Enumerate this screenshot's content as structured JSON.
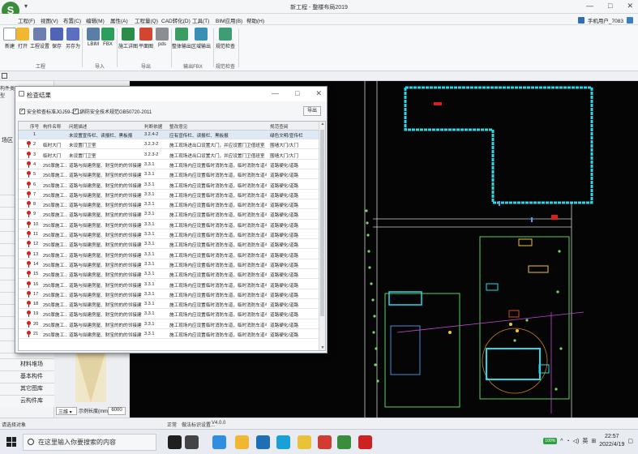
{
  "window": {
    "title": "新工程 - 整楼布局2019",
    "quick_access": "▾",
    "controls": [
      "—",
      "□",
      "✕"
    ]
  },
  "menu": {
    "items": [
      "工程(F)",
      "视图(V)",
      "布置(C)",
      "编辑(M)",
      "属性(A)",
      "工程量(Q)",
      "CAD转化(D)",
      "工具(T)",
      "BIM应用(B)",
      "帮助(H)"
    ],
    "user": "手机用户_7083"
  },
  "ribbon": {
    "buttons": [
      {
        "label": "新建",
        "icon": "new-file-icon",
        "color": "#e9eef5"
      },
      {
        "label": "打开",
        "icon": "open-folder-icon",
        "color": "#f2b731"
      },
      {
        "label": "工程设置",
        "icon": "project-settings-icon",
        "color": "#6c7fb0"
      },
      {
        "label": "保存",
        "icon": "save-icon",
        "color": "#4f63b8"
      },
      {
        "label": "另存为",
        "icon": "save-as-icon",
        "color": "#5a6fc0"
      },
      {
        "label": "LBIM",
        "icon": "lbim-icon",
        "color": "#5a7fa6"
      },
      {
        "label": "FBX",
        "icon": "fbx-icon",
        "color": "#2b9f5a"
      },
      {
        "label": "施工详图",
        "icon": "construction-drawing-icon",
        "color": "#2c8c4a"
      },
      {
        "label": "平面图",
        "icon": "floor-plan-icon",
        "color": "#d2462f"
      },
      {
        "label": "pds",
        "icon": "pds-icon",
        "color": "#8a8f96"
      },
      {
        "label": "整体输出",
        "icon": "export-all-icon",
        "color": "#3a9d63"
      },
      {
        "label": "区域输出",
        "icon": "export-region-icon",
        "color": "#3a8fb5"
      },
      {
        "label": "规范检查",
        "icon": "spec-check-icon",
        "color": "#3f9d76"
      }
    ],
    "groups": [
      "工程",
      "导入",
      "导出",
      "输出FBX",
      "规范检查"
    ]
  },
  "sidebar": {
    "header": "构件类型",
    "side_label": "场区",
    "items": [
      "材料堆场",
      "基本构件",
      "其它图库",
      "云构件库"
    ]
  },
  "preview": {
    "view_select": "三维",
    "scale_label": "示例长度(mm)",
    "scale_value": "6000"
  },
  "dialog": {
    "title": "检查结果",
    "checkboxes": [
      {
        "label": "安全检查标准JGJ59-2011",
        "checked": true
      },
      {
        "label": "消防安全技术规范GB50720-2011",
        "checked": true
      }
    ],
    "export_label": "导出",
    "columns": [
      "序号",
      "构件名称",
      "问题描述",
      "判断依据",
      "整改意见",
      "规范查阅"
    ],
    "rows": [
      {
        "no": "1",
        "pin": false,
        "name": "",
        "desc": "未设置宣传栏、读报栏、黑板报",
        "basis": "3.2.4-2",
        "fix": "应有宣传栏、读报栏、黑板报",
        "ref": "绿色文明/宣传栏"
      },
      {
        "no": "2",
        "pin": true,
        "name": "临时大门",
        "desc": "未设置门卫室",
        "basis": "3.2.3-2",
        "fix": "施工现场进出口设置大门，并应设置门卫值班室",
        "ref": "围墙大门/大门"
      },
      {
        "no": "3",
        "pin": true,
        "name": "临时大门",
        "desc": "未设置门卫室",
        "basis": "3.2.3-2",
        "fix": "施工现场进出口设置大门，并应设置门卫值班室",
        "ref": "围墙大门/大门"
      },
      {
        "no": "4",
        "pin": true,
        "name": "250厚施工...",
        "desc": "道路与拟建房屋、财宝的的的邻接建筑之...",
        "basis": "3.3.1",
        "fix": "施工现场内应设置临时消防车道，临时消防车道与在建...",
        "ref": "道路硬化/道路"
      },
      {
        "no": "5",
        "pin": true,
        "name": "250厚施工...",
        "desc": "道路与拟建房屋、财宝的的的邻接建筑之...",
        "basis": "3.3.1",
        "fix": "施工现场内应设置临时消防车道，临时消防车道与在建...",
        "ref": "道路硬化/道路"
      },
      {
        "no": "6",
        "pin": true,
        "name": "250厚施工...",
        "desc": "道路与拟建房屋、财宝的的的邻接建筑之...",
        "basis": "3.3.1",
        "fix": "施工现场内应设置临时消防车道，临时消防车道与在建...",
        "ref": "道路硬化/道路"
      },
      {
        "no": "7",
        "pin": true,
        "name": "250厚施工...",
        "desc": "道路与拟建房屋、财宝的的的邻接建筑之...",
        "basis": "3.3.1",
        "fix": "施工现场内应设置临时消防车道，临时消防车道与在建...",
        "ref": "道路硬化/道路"
      },
      {
        "no": "8",
        "pin": true,
        "name": "250厚施工...",
        "desc": "道路与拟建房屋、财宝的的的邻接建筑之...",
        "basis": "3.3.1",
        "fix": "施工现场内应设置临时消防车道，临时消防车道与在建...",
        "ref": "道路硬化/道路"
      },
      {
        "no": "9",
        "pin": true,
        "name": "250厚施工...",
        "desc": "道路与拟建房屋、财宝的的的邻接建筑之...",
        "basis": "3.3.1",
        "fix": "施工现场内应设置临时消防车道，临时消防车道与在建...",
        "ref": "道路硬化/道路"
      },
      {
        "no": "10",
        "pin": true,
        "name": "250厚施工...",
        "desc": "道路与拟建房屋、财宝的的的邻接建筑之...",
        "basis": "3.3.1",
        "fix": "施工现场内应设置临时消防车道，临时消防车道与在建...",
        "ref": "道路硬化/道路"
      },
      {
        "no": "11",
        "pin": true,
        "name": "250厚施工...",
        "desc": "道路与拟建房屋、财宝的的的邻接建筑之...",
        "basis": "3.3.1",
        "fix": "施工现场内应设置临时消防车道，临时消防车道与在建...",
        "ref": "道路硬化/道路"
      },
      {
        "no": "12",
        "pin": true,
        "name": "250厚施工...",
        "desc": "道路与拟建房屋、财宝的的的邻接建筑之...",
        "basis": "3.3.1",
        "fix": "施工现场内应设置临时消防车道，临时消防车道与在建...",
        "ref": "道路硬化/道路"
      },
      {
        "no": "13",
        "pin": true,
        "name": "250厚施工...",
        "desc": "道路与拟建房屋、财宝的的的邻接建筑之...",
        "basis": "3.3.1",
        "fix": "施工现场内应设置临时消防车道，临时消防车道与在建...",
        "ref": "道路硬化/道路"
      },
      {
        "no": "14",
        "pin": true,
        "name": "250厚施工...",
        "desc": "道路与拟建房屋、财宝的的的邻接建筑之...",
        "basis": "3.3.1",
        "fix": "施工现场内应设置临时消防车道，临时消防车道与在建...",
        "ref": "道路硬化/道路"
      },
      {
        "no": "15",
        "pin": true,
        "name": "250厚施工...",
        "desc": "道路与拟建房屋、财宝的的的邻接建筑之...",
        "basis": "3.3.1",
        "fix": "施工现场内应设置临时消防车道，临时消防车道与在建...",
        "ref": "道路硬化/道路"
      },
      {
        "no": "16",
        "pin": true,
        "name": "250厚施工...",
        "desc": "道路与拟建房屋、财宝的的的邻接建筑之...",
        "basis": "3.3.1",
        "fix": "施工现场内应设置临时消防车道，临时消防车道与在建...",
        "ref": "道路硬化/道路"
      },
      {
        "no": "17",
        "pin": true,
        "name": "250厚施工...",
        "desc": "道路与拟建房屋、财宝的的的邻接建筑之...",
        "basis": "3.3.1",
        "fix": "施工现场内应设置临时消防车道，临时消防车道与在建...",
        "ref": "道路硬化/道路"
      },
      {
        "no": "18",
        "pin": true,
        "name": "250厚施工...",
        "desc": "道路与拟建房屋、财宝的的的邻接建筑之...",
        "basis": "3.3.1",
        "fix": "施工现场内应设置临时消防车道，临时消防车道与在建...",
        "ref": "道路硬化/道路"
      },
      {
        "no": "19",
        "pin": true,
        "name": "250厚施工...",
        "desc": "道路与拟建房屋、财宝的的的邻接建筑之...",
        "basis": "3.3.1",
        "fix": "施工现场内应设置临时消防车道，临时消防车道与在建...",
        "ref": "道路硬化/道路"
      },
      {
        "no": "20",
        "pin": true,
        "name": "250厚施工...",
        "desc": "道路与拟建房屋、财宝的的的邻接建筑之...",
        "basis": "3.3.1",
        "fix": "施工现场内应设置临时消防车道，临时消防车道与在建...",
        "ref": "道路硬化/道路"
      },
      {
        "no": "21",
        "pin": true,
        "name": "250厚施工...",
        "desc": "道路与拟建房屋、财宝的的的邻接建筑之...",
        "basis": "3.3.1",
        "fix": "施工现场内应设置临时消防车道，临时消防车道与在建...",
        "ref": "道路硬化/道路"
      }
    ]
  },
  "statusbar": {
    "left": "请选择对象",
    "tab1": "正常",
    "tab2": "做法标识设置...",
    "version": "V4.0.0"
  },
  "taskbar": {
    "search_placeholder": "在这里输入你要搜索的内容",
    "apps": [
      {
        "icon": "cortana-icon",
        "color": "#1f1f1f"
      },
      {
        "icon": "task-view-icon",
        "color": "#444"
      },
      {
        "icon": "chrome-icon",
        "color": "#2f8ee0"
      },
      {
        "icon": "file-explorer-icon",
        "color": "#f2b731"
      },
      {
        "icon": "mail-icon",
        "color": "#1f6fb5"
      },
      {
        "icon": "edge-icon",
        "color": "#1aa0d8"
      },
      {
        "icon": "notes-icon",
        "color": "#e9c23a"
      },
      {
        "icon": "wps-icon",
        "color": "#d23b32"
      },
      {
        "icon": "sdzy-app-icon",
        "color": "#3a8d3a"
      },
      {
        "icon": "app-red-icon",
        "color": "#cc2222"
      }
    ],
    "battery": "100%",
    "ime": "英",
    "time": "22:57",
    "date": "2022/4/19"
  },
  "colors": {
    "canvas": "#050505",
    "building": "#27d8e8",
    "pin": "#d7201b"
  }
}
